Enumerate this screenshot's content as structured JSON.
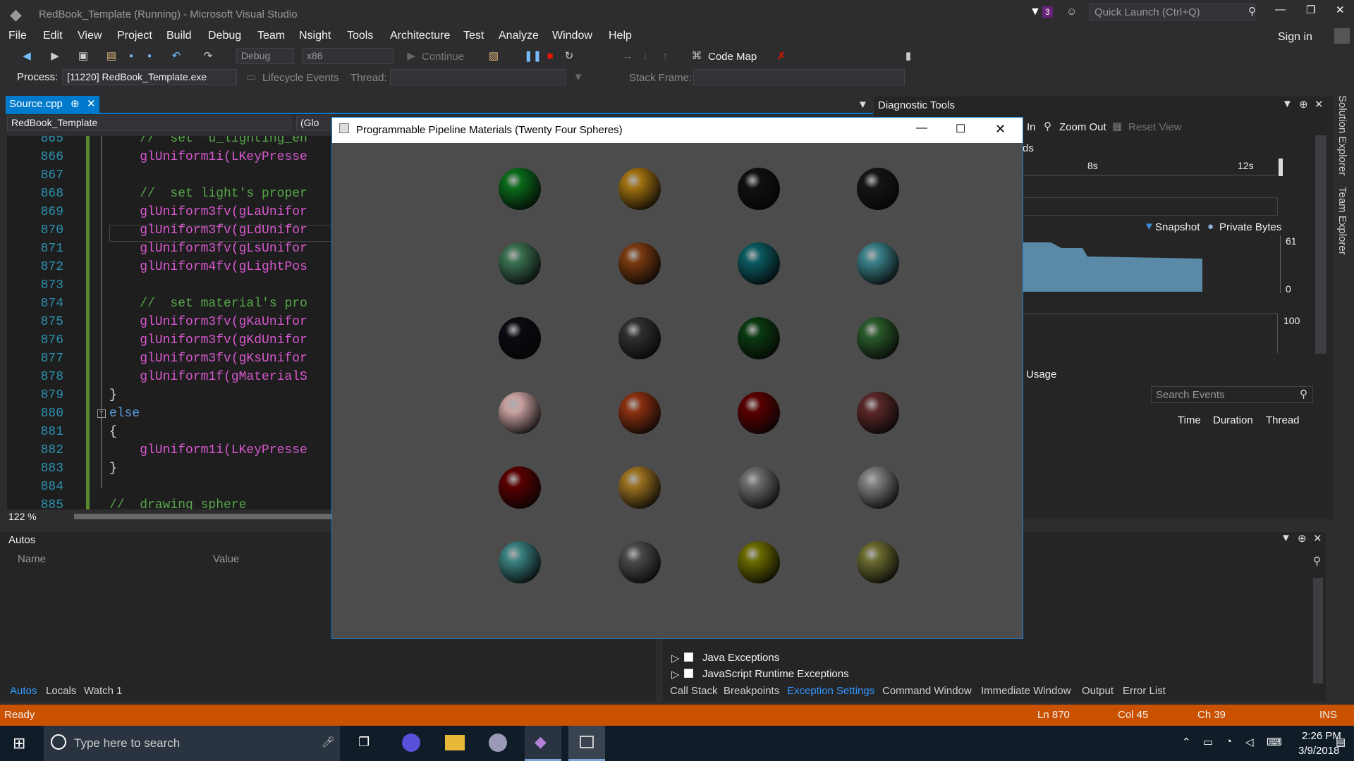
{
  "window": {
    "title": "RedBook_Template (Running) - Microsoft Visual Studio",
    "quick_launch": "Quick Launch (Ctrl+Q)",
    "notif_count": "3",
    "sign_in": "Sign in"
  },
  "menu": [
    "File",
    "Edit",
    "View",
    "Project",
    "Build",
    "Debug",
    "Team",
    "Nsight",
    "Tools",
    "Architecture",
    "Test",
    "Analyze",
    "Window",
    "Help"
  ],
  "toolbar": {
    "config": "Debug",
    "platform": "x86",
    "continue": "Continue",
    "code_map": "Code Map"
  },
  "procbar": {
    "process_label": "Process:",
    "process": "[11220] RedBook_Template.exe",
    "lifecycle": "Lifecycle Events",
    "thread_label": "Thread:",
    "stack_label": "Stack Frame:"
  },
  "editor": {
    "tab": "Source.cpp",
    "nav": "RedBook_Template",
    "nav2": "(Glo",
    "zoom": "122 %",
    "lines": [
      {
        "n": "865",
        "c": "    //  set \"u_lighting_en",
        "k": "cm"
      },
      {
        "n": "866",
        "c": "    glUniform1i(LKeyPresse",
        "k": "fn"
      },
      {
        "n": "867",
        "c": "",
        "k": "tx"
      },
      {
        "n": "868",
        "c": "    //  set light's proper",
        "k": "cm"
      },
      {
        "n": "869",
        "c": "    glUniform3fv(gLaUnifor",
        "k": "fn"
      },
      {
        "n": "870",
        "c": "    glUniform3fv(gLdUnifor",
        "k": "fn"
      },
      {
        "n": "871",
        "c": "    glUniform3fv(gLsUnifor",
        "k": "fn"
      },
      {
        "n": "872",
        "c": "    glUniform4fv(gLightPos",
        "k": "fn"
      },
      {
        "n": "873",
        "c": "",
        "k": "tx"
      },
      {
        "n": "874",
        "c": "    //  set material's pro",
        "k": "cm"
      },
      {
        "n": "875",
        "c": "    glUniform3fv(gKaUnifor",
        "k": "fn"
      },
      {
        "n": "876",
        "c": "    glUniform3fv(gKdUnifor",
        "k": "fn"
      },
      {
        "n": "877",
        "c": "    glUniform3fv(gKsUnifor",
        "k": "fn"
      },
      {
        "n": "878",
        "c": "    glUniform1f(gMaterialS",
        "k": "fn"
      },
      {
        "n": "879",
        "c": "}",
        "k": "tx"
      },
      {
        "n": "880",
        "c": "else",
        "k": "kw"
      },
      {
        "n": "881",
        "c": "{",
        "k": "tx"
      },
      {
        "n": "882",
        "c": "    glUniform1i(LKeyPresse",
        "k": "fn"
      },
      {
        "n": "883",
        "c": "}",
        "k": "tx"
      },
      {
        "n": "884",
        "c": "",
        "k": "tx"
      },
      {
        "n": "885",
        "c": "//  drawing sphere",
        "k": "cm"
      }
    ]
  },
  "gl_window": {
    "title": "Programmable Pipeline Materials (Twenty Four Spheres)",
    "spheres": [
      [
        "#0a6a1a",
        "#a07010",
        "#101010",
        "#151515"
      ],
      [
        "#3a7050",
        "#7a3a10",
        "#0a5a60",
        "#3a8088"
      ],
      [
        "#0a0a12",
        "#303030",
        "#0a3a10",
        "#2a5a2a"
      ],
      [
        "#c8a0a0",
        "#8a3010",
        "#5a0000",
        "#5a2828"
      ],
      [
        "#5a0000",
        "#9a7020",
        "#6a6a6a",
        "#7a7a7a"
      ],
      [
        "#3a8080",
        "#4a4a4a",
        "#6a6a00",
        "#6a6a30"
      ]
    ]
  },
  "diagnostic": {
    "title": "Diagnostic Tools",
    "zoom_in": "In",
    "zoom_out": "Zoom Out",
    "reset": "Reset View",
    "ds": "ds",
    "t8": "8s",
    "t12": "12s",
    "snapshot": "Snapshot",
    "private_bytes": "Private Bytes",
    "v61": "61",
    "v0": "0",
    "v100": "100",
    "usage": "Usage",
    "search": "Search Events",
    "col_time": "Time",
    "col_duration": "Duration",
    "col_thread": "Thread"
  },
  "autos": {
    "title": "Autos",
    "col_name": "Name",
    "col_value": "Value",
    "tabs": [
      "Autos",
      "Locals",
      "Watch 1"
    ]
  },
  "exceptions": {
    "items": [
      "Java Exceptions",
      "JavaScript Runtime Exceptions"
    ],
    "tabs": [
      "Call Stack",
      "Breakpoints",
      "Exception Settings",
      "Command Window",
      "Immediate Window",
      "Output",
      "Error List"
    ]
  },
  "side": {
    "solution": "Solution Explorer",
    "team": "Team Explorer"
  },
  "status": {
    "ready": "Ready",
    "ln": "Ln 870",
    "col": "Col 45",
    "ch": "Ch 39",
    "ins": "INS"
  },
  "taskbar": {
    "search": "Type here to search",
    "time": "2:26 PM",
    "date": "3/9/2018"
  }
}
